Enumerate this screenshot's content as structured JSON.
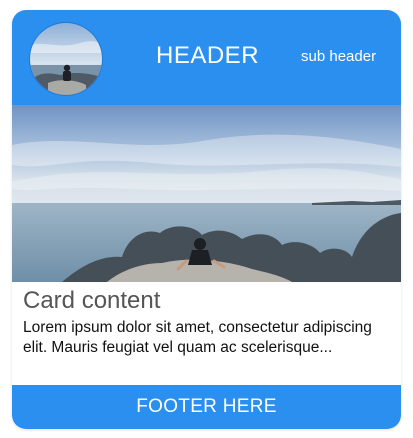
{
  "header": {
    "title": "HEADER",
    "sub_title": "sub header"
  },
  "content": {
    "title": "Card content",
    "body": "Lorem ipsum dolor sit amet, consectetur adipiscing elit. Mauris feugiat vel quam ac scelerisque..."
  },
  "footer": {
    "label": "FOOTER HERE"
  },
  "colors": {
    "accent": "#2b8ff0",
    "text_primary": "#111111",
    "text_secondary": "#555555"
  },
  "icons": {
    "avatar": "avatar-photo",
    "hero": "hero-photo"
  }
}
